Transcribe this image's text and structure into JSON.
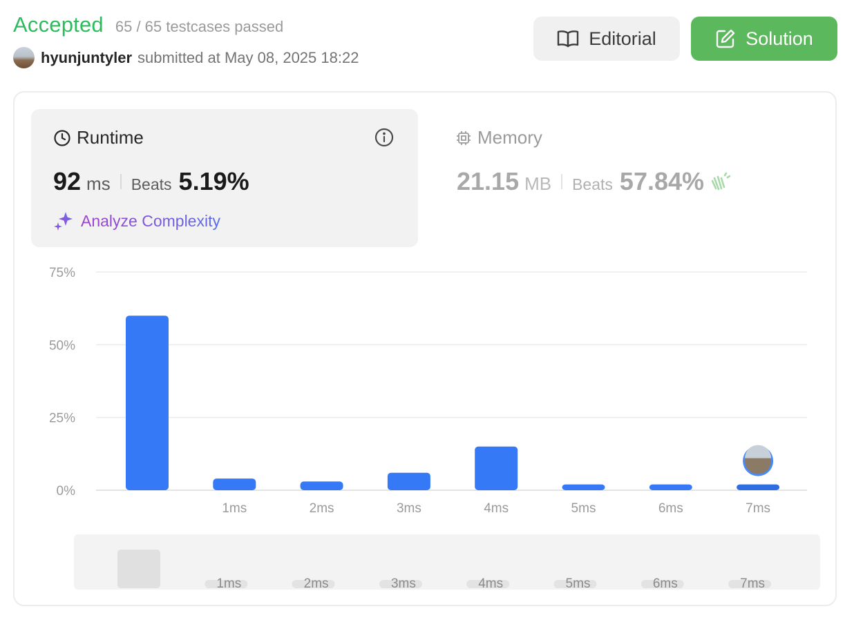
{
  "header": {
    "status": "Accepted",
    "testcases": "65 / 65 testcases passed",
    "username": "hyunjuntyler",
    "submitted": "submitted at May 08, 2025 18:22"
  },
  "buttons": {
    "editorial": "Editorial",
    "solution": "Solution"
  },
  "runtime": {
    "title": "Runtime",
    "value": "92",
    "unit": "ms",
    "beats_label": "Beats",
    "beats": "5.19%",
    "analyze": "Analyze Complexity"
  },
  "memory": {
    "title": "Memory",
    "value": "21.15",
    "unit": "MB",
    "beats_label": "Beats",
    "beats": "57.84%"
  },
  "colors": {
    "accepted": "#2cbb5d",
    "solution": "#5cb85c",
    "bar": "#3579f6",
    "bar_active": "#2f6ee0"
  },
  "chart_data": {
    "type": "bar",
    "categories": [
      "",
      "1ms",
      "2ms",
      "3ms",
      "4ms",
      "5ms",
      "6ms",
      "7ms"
    ],
    "values": [
      60,
      4,
      3,
      6,
      15,
      2,
      2,
      2
    ],
    "y_ticks": [
      "75%",
      "50%",
      "25%",
      "0%"
    ],
    "ylim": [
      0,
      75
    ],
    "grid": true,
    "highlight_index": 7
  },
  "navigator": {
    "categories": [
      "",
      "1ms",
      "2ms",
      "3ms",
      "4ms",
      "5ms",
      "6ms",
      "7ms"
    ]
  }
}
